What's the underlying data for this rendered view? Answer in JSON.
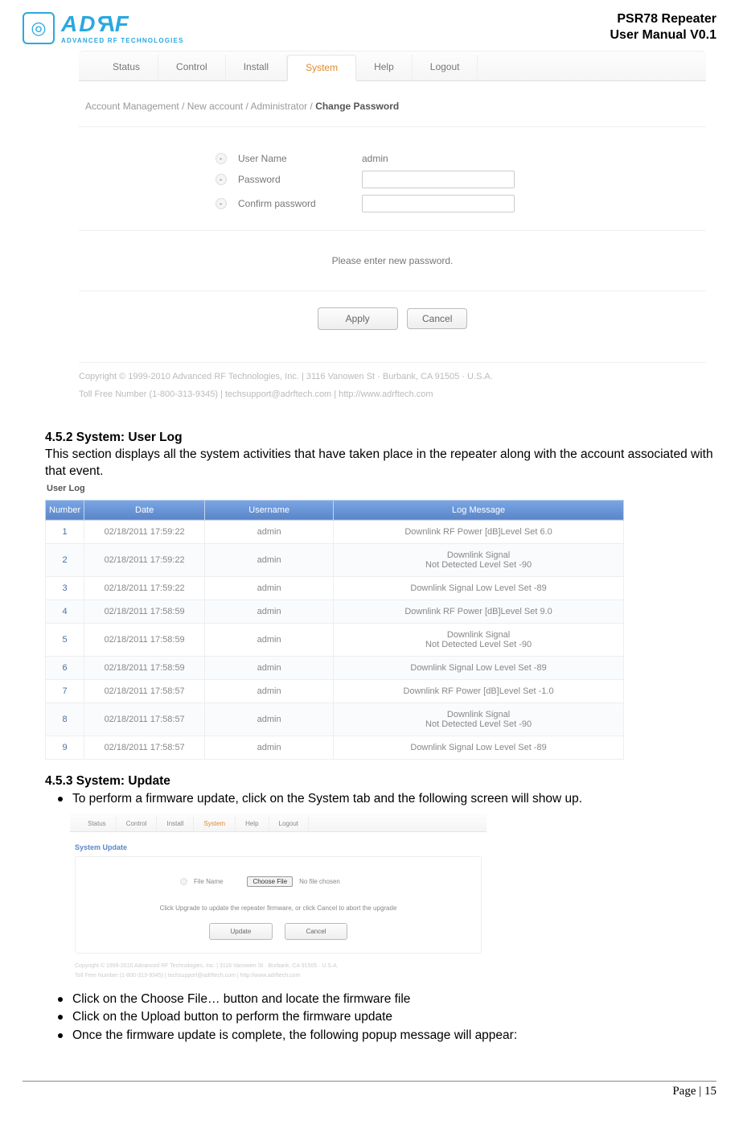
{
  "header": {
    "logo_main_pre": "AD",
    "logo_main_r1": "R",
    "logo_main_post": "F",
    "logo_sub": "ADVANCED RF TECHNOLOGIES",
    "title_line1": "PSR78 Repeater",
    "title_line2": "User Manual V0.1"
  },
  "screenshot1": {
    "tabs": [
      "Status",
      "Control",
      "Install",
      "System",
      "Help",
      "Logout"
    ],
    "active_tab_index": 3,
    "breadcrumb_parts": [
      "Account Management",
      "New account",
      "Administrator"
    ],
    "breadcrumb_strong": "Change Password",
    "form": {
      "username_label": "User Name",
      "username_value": "admin",
      "password_label": "Password",
      "confirm_label": "Confirm password"
    },
    "message": "Please enter new password.",
    "apply_label": "Apply",
    "cancel_label": "Cancel",
    "copyright_line1": "Copyright © 1999-2010 Advanced RF Technologies, Inc. | 3116 Vanowen St · Burbank, CA 91505 · U.S.A.",
    "copyright_line2": "Toll Free Number (1-800-313-9345) | techsupport@adrftech.com | http://www.adrftech.com"
  },
  "section_452_head": "4.5.2 System: User Log",
  "section_452_body": "This section displays all the system activities that have taken place in the repeater along with the account associated with that event.",
  "userlog": {
    "caption": "User Log",
    "headers": [
      "Number",
      "Date",
      "Username",
      "Log Message"
    ],
    "rows": [
      {
        "num": "1",
        "date": "02/18/2011 17:59:22",
        "user": "admin",
        "msg": "Downlink RF Power [dB]Level Set 6.0"
      },
      {
        "num": "2",
        "date": "02/18/2011 17:59:22",
        "user": "admin",
        "msg": "Downlink Signal\nNot Detected Level Set -90"
      },
      {
        "num": "3",
        "date": "02/18/2011 17:59:22",
        "user": "admin",
        "msg": "Downlink Signal Low Level Set -89"
      },
      {
        "num": "4",
        "date": "02/18/2011 17:58:59",
        "user": "admin",
        "msg": "Downlink RF Power [dB]Level Set 9.0"
      },
      {
        "num": "5",
        "date": "02/18/2011 17:58:59",
        "user": "admin",
        "msg": "Downlink Signal\nNot Detected Level Set -90"
      },
      {
        "num": "6",
        "date": "02/18/2011 17:58:59",
        "user": "admin",
        "msg": "Downlink Signal Low Level Set -89"
      },
      {
        "num": "7",
        "date": "02/18/2011 17:58:57",
        "user": "admin",
        "msg": "Downlink RF Power [dB]Level Set -1.0"
      },
      {
        "num": "8",
        "date": "02/18/2011 17:58:57",
        "user": "admin",
        "msg": "Downlink Signal\nNot Detected Level Set -90"
      },
      {
        "num": "9",
        "date": "02/18/2011 17:58:57",
        "user": "admin",
        "msg": "Downlink Signal Low Level Set -89"
      }
    ]
  },
  "section_453_head": "4.5.3 System: Update",
  "bullets": [
    "To perform a firmware update, click on the System tab and the following screen will show up.",
    "Click on the Choose File… button and locate the firmware file",
    "Click on the Upload button to perform the firmware update",
    "Once the firmware update is complete, the following popup message will appear:"
  ],
  "screenshot2": {
    "tabs": [
      "Status",
      "Control",
      "Install",
      "System",
      "Help",
      "Logout"
    ],
    "active_tab_index": 3,
    "section_title": "System Update",
    "file_label": "File Name",
    "choose_label": "Choose File",
    "no_file": "No file chosen",
    "msg": "Click Upgrade to update the repeater firmware, or click Cancel to abort the upgrade",
    "update_label": "Update",
    "cancel_label": "Cancel",
    "copyright_line1": "Copyright © 1999-2010 Advanced RF Technologies, Inc. | 3116 Vanowen St · Burbank, CA 91505 · U.S.A.",
    "copyright_line2": "Toll Free Number (1-800-313-9345) | techsupport@adrftech.com | http://www.adrftech.com"
  },
  "page_number": "Page | 15"
}
